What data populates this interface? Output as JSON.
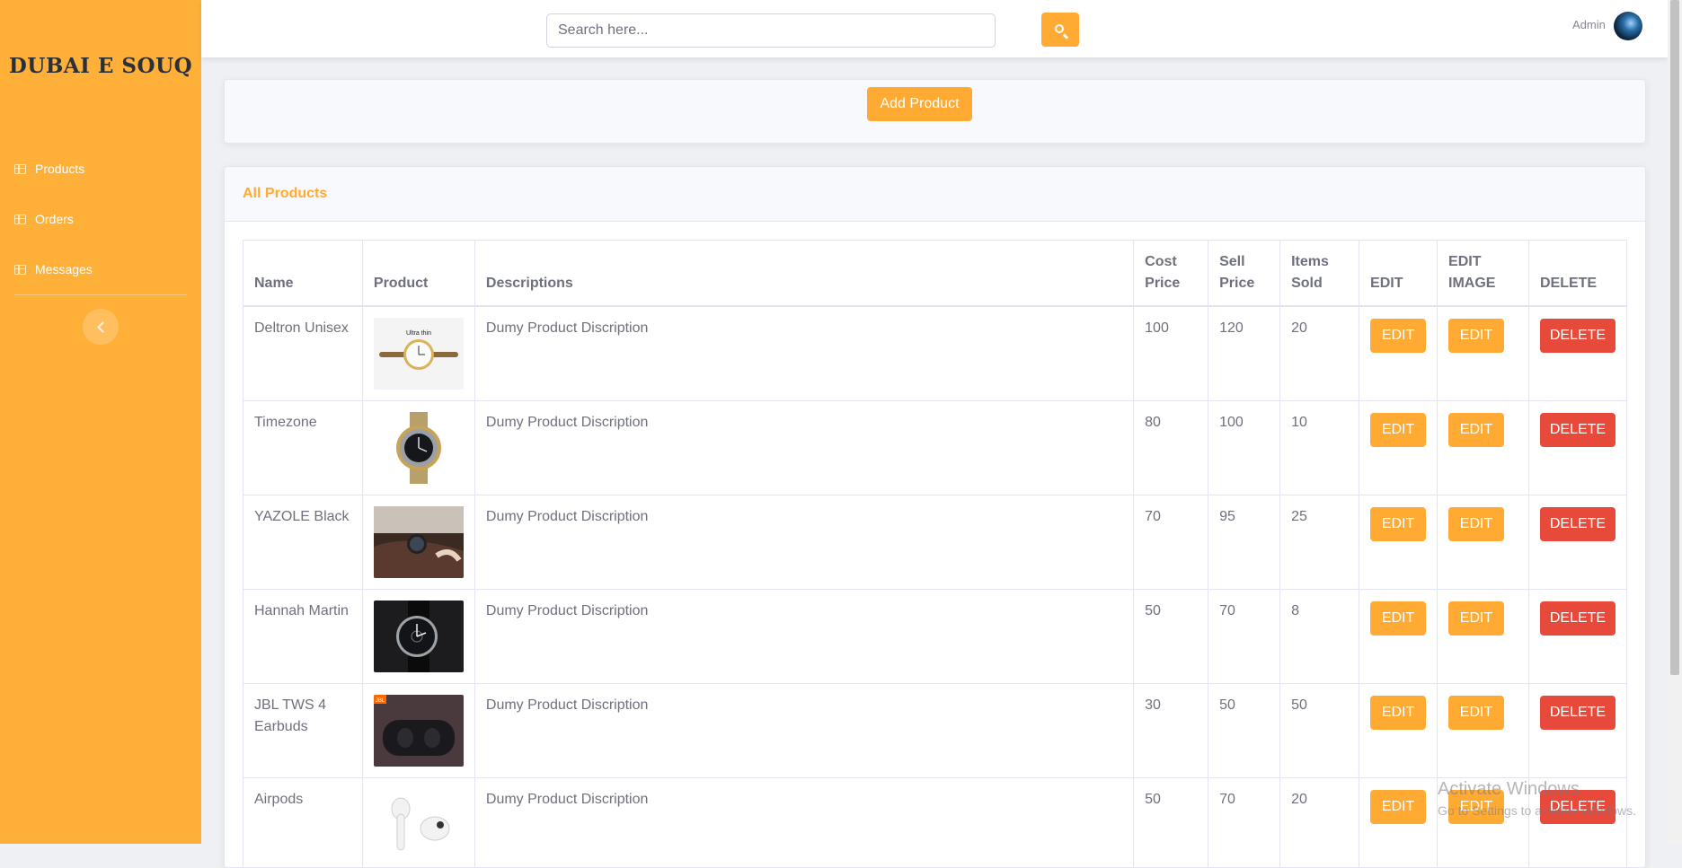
{
  "sidebar": {
    "brand": "DUBAI E SOUQ",
    "items": [
      {
        "label": "Products",
        "icon": "table-icon"
      },
      {
        "label": "Orders",
        "icon": "table-icon"
      },
      {
        "label": "Messages",
        "icon": "table-icon"
      }
    ],
    "toggle_icon": "chevron-left-icon"
  },
  "topbar": {
    "search_placeholder": "Search here...",
    "search_icon": "search-icon",
    "user_name": "Admin"
  },
  "actions": {
    "add_product_label": "Add Product"
  },
  "products": {
    "title": "All Products",
    "columns": [
      "Name",
      "Product",
      "Descriptions",
      "Cost Price",
      "Sell Price",
      "Items Sold",
      "EDIT",
      "EDIT IMAGE",
      "DELETE"
    ],
    "rows": [
      {
        "name": "Deltron Unisex",
        "image": "gold-watch-thumbnail",
        "image_caption": "Ultra thin",
        "description": "Dumy Product Discription",
        "cost": "100",
        "sell": "120",
        "sold": "20"
      },
      {
        "name": "Timezone",
        "image": "steel-gold-watch-thumbnail",
        "description": "Dumy Product Discription",
        "cost": "80",
        "sell": "100",
        "sold": "10"
      },
      {
        "name": "YAZOLE Black",
        "image": "wrist-watch-photo-thumbnail",
        "description": "Dumy Product Discription",
        "cost": "70",
        "sell": "95",
        "sold": "25"
      },
      {
        "name": "Hannah Martin",
        "image": "black-leather-watch-thumbnail",
        "description": "Dumy Product Discription",
        "cost": "50",
        "sell": "70",
        "sold": "8"
      },
      {
        "name": "JBL TWS 4 Earbuds",
        "image": "earbuds-case-thumbnail",
        "image_caption": "JBL",
        "description": "Dumy Product Discription",
        "cost": "30",
        "sell": "50",
        "sold": "50"
      },
      {
        "name": "Airpods",
        "image": "airpods-thumbnail",
        "description": "Dumy Product Discription",
        "cost": "50",
        "sell": "70",
        "sold": "20"
      }
    ],
    "edit_label": "EDIT",
    "edit_image_label": "EDIT",
    "delete_label": "DELETE"
  },
  "watermark": {
    "line1": "Activate Windows",
    "line2": "Go to Settings to activate Windows."
  },
  "colors": {
    "sidebar": "#ffb038",
    "accent": "#ffab33",
    "danger": "#e74a3b"
  }
}
